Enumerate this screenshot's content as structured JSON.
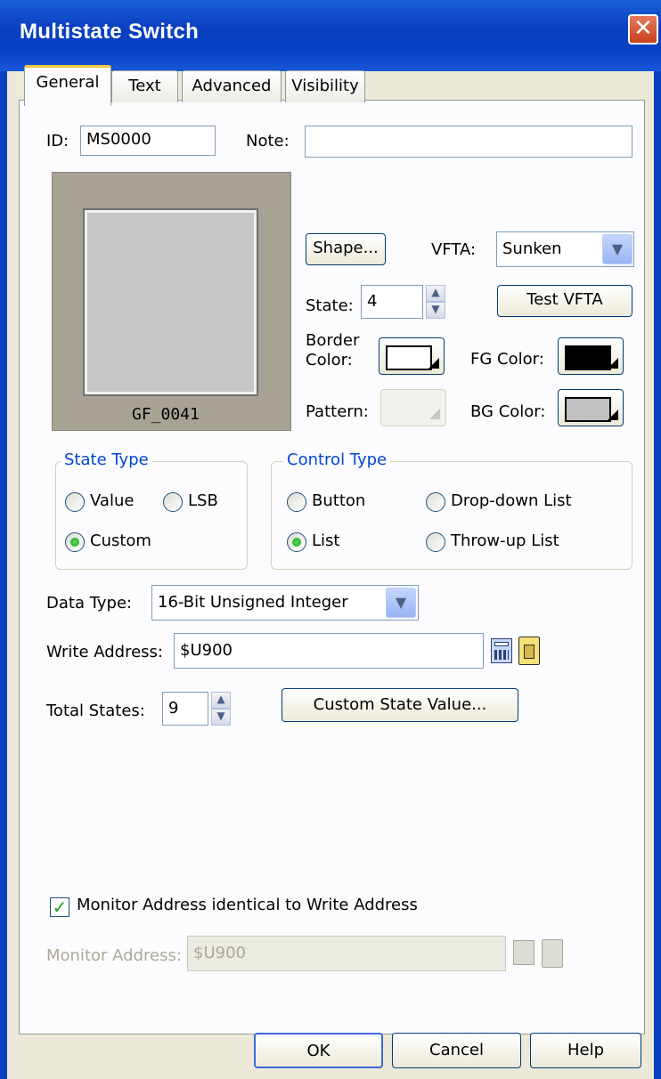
{
  "window": {
    "title": "Multistate Switch",
    "close_glyph": "✕"
  },
  "tabs": [
    {
      "label": "General"
    },
    {
      "label": "Text"
    },
    {
      "label": "Advanced"
    },
    {
      "label": "Visibility"
    }
  ],
  "general": {
    "id_label": "ID:",
    "id_value": "MS0000",
    "note_label": "Note:",
    "note_value": "",
    "preview_caption": "GF_0041",
    "shape_button": "Shape...",
    "vfta_label": "VFTA:",
    "vfta_value": "Sunken",
    "state_label": "State:",
    "state_value": "4",
    "test_vfta_button": "Test VFTA",
    "border_color_label_1": "Border",
    "border_color_label_2": "Color:",
    "fg_color_label": "FG Color:",
    "pattern_label": "Pattern:",
    "bg_color_label": "BG Color:"
  },
  "colors": {
    "border_color": "#ffffff",
    "fg_color": "#000000",
    "bg_color": "#c0c0c0",
    "preview_bg": "#a8a294",
    "preview_inner": "#c7c7c7"
  },
  "state_type": {
    "legend": "State Type",
    "options": [
      {
        "label": "Value",
        "selected": false
      },
      {
        "label": "LSB",
        "selected": false
      },
      {
        "label": "Custom",
        "selected": true
      }
    ]
  },
  "control_type": {
    "legend": "Control Type",
    "options": [
      {
        "label": "Button",
        "selected": false
      },
      {
        "label": "Drop-down List",
        "selected": false
      },
      {
        "label": "List",
        "selected": true
      },
      {
        "label": "Throw-up List",
        "selected": false
      }
    ]
  },
  "data_type": {
    "label": "Data Type:",
    "value": "16-Bit Unsigned Integer"
  },
  "write_address": {
    "label": "Write Address:",
    "value": "$U900"
  },
  "total_states": {
    "label": "Total States:",
    "value": "9"
  },
  "custom_state_button": "Custom State Value...",
  "monitor": {
    "checkbox_label": "Monitor Address identical to Write Address",
    "checked": true,
    "address_label": "Monitor Address:",
    "address_value": "$U900"
  },
  "footer": {
    "ok": "OK",
    "cancel": "Cancel",
    "help": "Help"
  }
}
